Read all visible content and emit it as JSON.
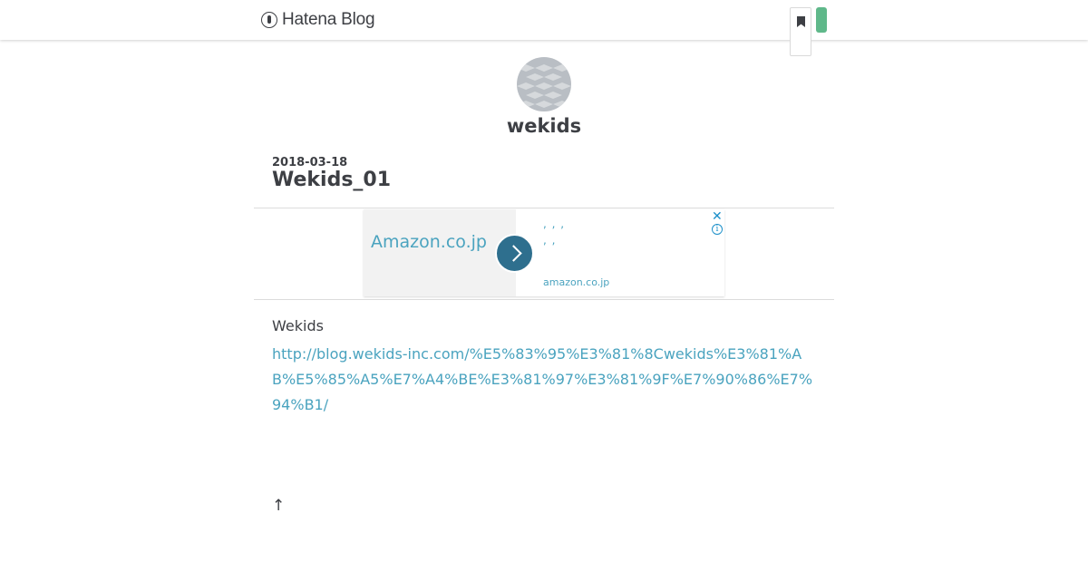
{
  "header": {
    "logo_text": "Hatena Blog",
    "accent_color": "#5fb88a"
  },
  "blog": {
    "title": "wekids"
  },
  "entry": {
    "date": "2018-03-18",
    "title": "Wekids_01",
    "body_text": "Wekids",
    "link_text": "http://blog.wekids-inc.com/%E5%83%95%E3%81%8Cwekids%E3%81%AB%E5%85%A5%E7%A4%BE%E3%81%97%E3%81%9F%E7%90%86%E7%94%B1/"
  },
  "ad": {
    "brand": "Amazon.co.jp",
    "line1": ", , ,",
    "line2": ", ,",
    "domain": "amazon.co.jp",
    "close_glyph": "✕",
    "info_glyph": "i"
  },
  "footer": {
    "back_to_top": "↑"
  }
}
